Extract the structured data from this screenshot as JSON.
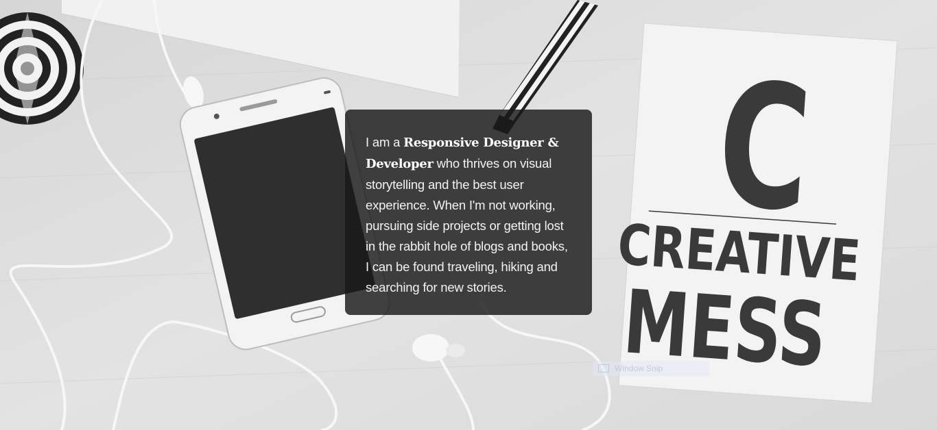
{
  "about": {
    "intro": "I am a ",
    "highlight_1": "Responsive Designer &",
    "highlight_2": "Developer",
    "body_1": " who thrives on visual storytelling and the best user experience. When I'm not working, pursuing side projects or getting lost in the rabbit hole of blogs and books, I can be found traveling, hiking and searching for new stories."
  },
  "notebook": {
    "letter": "C",
    "line_1": "CREATIVE",
    "line_2": "MESS"
  },
  "overlay": {
    "snip_label": "Window Snip"
  },
  "colors": {
    "card_bg": "#181818",
    "card_text": "#f2f2f2",
    "notebook_ink": "#3a3a3a",
    "desk": "#dcdcdc"
  },
  "icons": {
    "snip": "window-snip-icon"
  }
}
